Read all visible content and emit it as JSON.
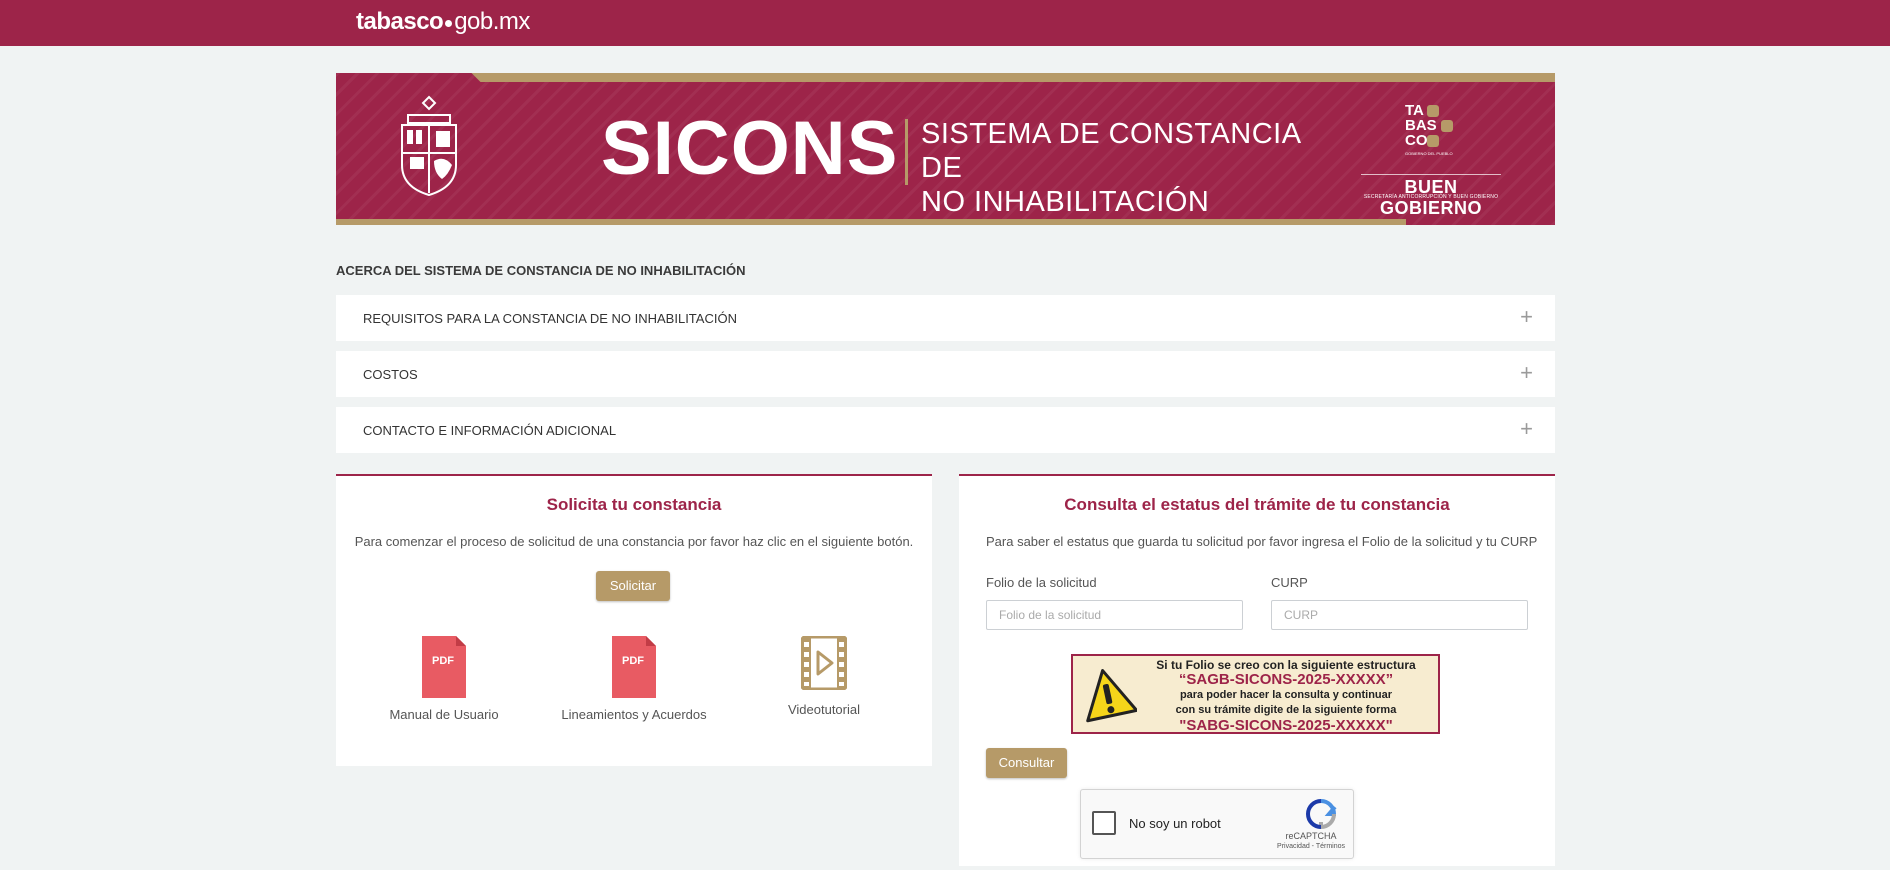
{
  "topbar": {
    "brand_bold": "tabasco",
    "brand_rest": "gob.mx"
  },
  "banner": {
    "title": "SICONS",
    "subtitle_line1": "SISTEMA DE CONSTANCIA DE",
    "subtitle_line2": "NO INHABILITACIÓN",
    "logo_lines": [
      "TA",
      "BAS",
      "CO"
    ],
    "logo_tagline": "GOBIERNO DEL PUEBLO",
    "gov_title": "BUEN GOBIERNO",
    "gov_subtitle": "SECRETARÍA ANTICORRUPCIÓN Y BUEN GOBIERNO"
  },
  "about": {
    "title": "ACERCA DEL SISTEMA DE CONSTANCIA DE NO INHABILITACIÓN",
    "items": [
      {
        "label": "REQUISITOS PARA LA CONSTANCIA DE NO INHABILITACIÓN",
        "icon": "+"
      },
      {
        "label": "COSTOS",
        "icon": "+"
      },
      {
        "label": "CONTACTO E INFORMACIÓN ADICIONAL",
        "icon": "+"
      }
    ]
  },
  "solicita": {
    "title": "Solicita tu constancia",
    "text": "Para comenzar el proceso de solicitud de una constancia por favor haz clic en el siguiente botón.",
    "button": "Solicitar",
    "resources": [
      {
        "label": "Manual de Usuario",
        "icon": "pdf-icon",
        "badge": "PDF"
      },
      {
        "label": "Lineamientos y Acuerdos",
        "icon": "pdf-icon",
        "badge": "PDF"
      },
      {
        "label": "Videotutorial",
        "icon": "video-icon"
      }
    ]
  },
  "consulta": {
    "title": "Consulta el estatus del trámite de tu constancia",
    "text": "Para saber el estatus que guarda tu solicitud por favor ingresa el Folio de la solicitud y tu CURP",
    "folio_label": "Folio de la solicitud",
    "folio_placeholder": "Folio de la solicitud",
    "curp_label": "CURP",
    "curp_placeholder": "CURP",
    "notice": {
      "line1": "Si tu Folio se creo con la siguiente estructura",
      "line2": "“SAGB-SICONS-2025-XXXXX”",
      "line3": "para poder hacer la consulta y continuar",
      "line4": "con su trámite digite de la siguiente forma",
      "line5": "\"SABG-SICONS-2025-XXXXX\""
    },
    "button": "Consultar",
    "captcha": {
      "label": "No soy un robot",
      "brand": "reCAPTCHA",
      "links": "Privacidad - Términos"
    }
  },
  "colors": {
    "primary": "#9d2449",
    "gold": "#b69a68",
    "background": "#f0f3f3",
    "pdf_red": "#e85b63"
  }
}
